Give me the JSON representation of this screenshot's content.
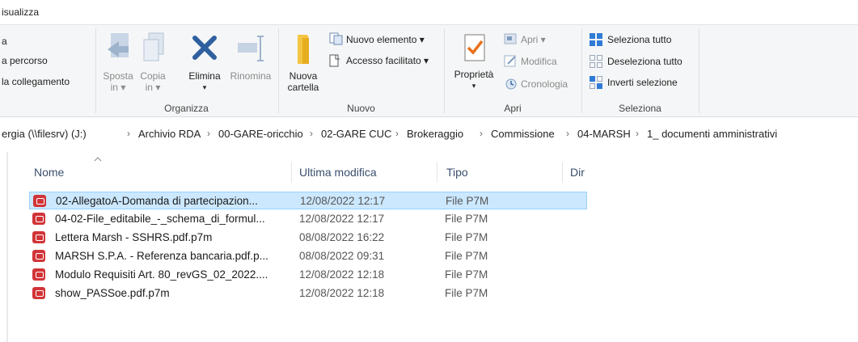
{
  "tabs": {
    "view": "isualizza"
  },
  "ribbon": {
    "clipboard_left": {
      "item1": "a",
      "item2": "a percorso",
      "item3": "la collegamento"
    },
    "organize": {
      "label": "Organizza",
      "move": "Sposta",
      "move_sub": "in ▾",
      "copy": "Copia",
      "copy_sub": "in ▾",
      "delete": "Elimina",
      "rename": "Rinomina"
    },
    "new": {
      "label": "Nuovo",
      "new_folder_line1": "Nuova",
      "new_folder_line2": "cartella",
      "new_item": "Nuovo elemento ▾",
      "easy_access": "Accesso facilitato ▾"
    },
    "open": {
      "label": "Apri",
      "properties": "Proprietà",
      "open": "Apri ▾",
      "edit": "Modifica",
      "history": "Cronologia"
    },
    "select": {
      "label": "Seleziona",
      "select_all": "Seleziona tutto",
      "select_none": "Deseleziona tutto",
      "invert": "Inverti selezione"
    }
  },
  "address": {
    "crumbs": [
      "ergia (\\\\filesrv) (J:)",
      "Archivio RDA",
      "00-GARE-oricchio",
      "02-GARE CUC",
      "Brokeraggio",
      "Commissione",
      "04-MARSH",
      "1_ documenti amministrativi"
    ]
  },
  "columns": {
    "name": "Nome",
    "modified": "Ultima modifica",
    "type": "Tipo",
    "size": "Dir"
  },
  "files": [
    {
      "name": "02-AllegatoA-Domanda di partecipazion...",
      "modified": "12/08/2022 12:17",
      "type": "File P7M"
    },
    {
      "name": "04-02-File_editabile_-_schema_di_formul...",
      "modified": "12/08/2022 12:17",
      "type": "File P7M"
    },
    {
      "name": "Lettera Marsh -  SSHRS.pdf.p7m",
      "modified": "08/08/2022 16:22",
      "type": "File P7M"
    },
    {
      "name": "MARSH S.P.A. - Referenza bancaria.pdf.p...",
      "modified": "08/08/2022 09:31",
      "type": "File P7M"
    },
    {
      "name": "Modulo Requisiti Art. 80_revGS_02_2022....",
      "modified": "12/08/2022 12:18",
      "type": "File P7M"
    },
    {
      "name": "show_PASSoe.pdf.p7m",
      "modified": "12/08/2022 12:18",
      "type": "File P7M"
    }
  ],
  "colors": {
    "selection": "#cce8ff",
    "selection_border": "#99d1ff",
    "file_icon": "#d13438",
    "accent": "#0078d4"
  }
}
